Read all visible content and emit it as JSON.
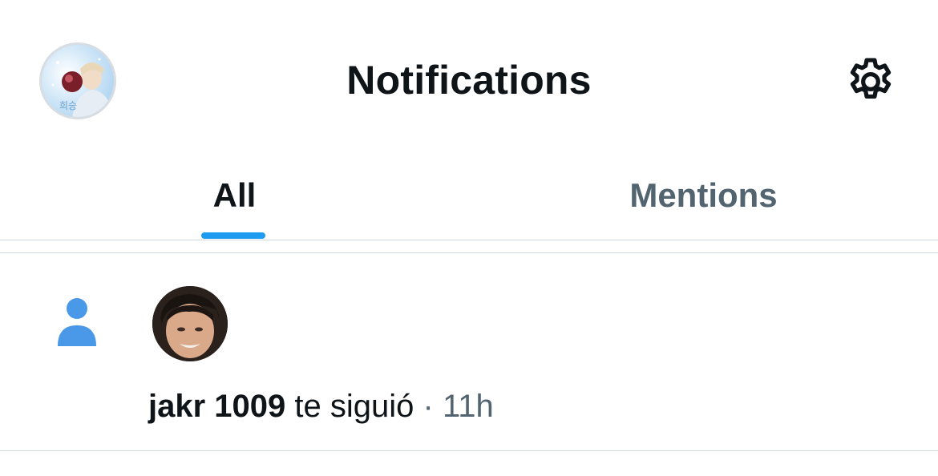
{
  "header": {
    "title": "Notifications",
    "avatar_icon": "profile-avatar",
    "settings_icon": "gear-icon"
  },
  "tabs": [
    {
      "label": "All",
      "active": true
    },
    {
      "label": "Mentions",
      "active": false
    }
  ],
  "colors": {
    "accent": "#1d9bf0",
    "text_primary": "#0f1419",
    "text_secondary": "#536471",
    "divider": "#cfd9de"
  },
  "notifications": [
    {
      "type_icon": "person-icon",
      "user": "jakr 1009",
      "action": "te siguió",
      "separator": "·",
      "time": "11h"
    }
  ]
}
